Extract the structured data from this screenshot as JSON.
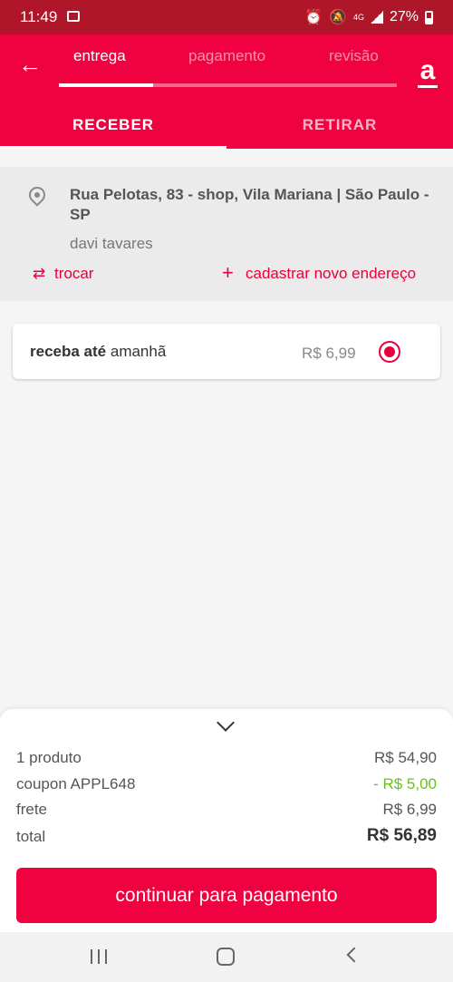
{
  "status_bar": {
    "time": "11:49",
    "network": "4G",
    "battery": "27%"
  },
  "header": {
    "steps": [
      {
        "label": "entrega",
        "active": true
      },
      {
        "label": "pagamento",
        "active": false
      },
      {
        "label": "revisão",
        "active": false
      }
    ],
    "progress_fraction": 0.28,
    "logo": "a",
    "tabs": [
      {
        "label": "RECEBER",
        "active": true
      },
      {
        "label": "RETIRAR",
        "active": false
      }
    ]
  },
  "address": {
    "line": "Rua Pelotas, 83 - shop, Vila Mariana | São Paulo - SP",
    "name": "davi tavares",
    "swap_label": "trocar",
    "new_address_label": "cadastrar novo endereço"
  },
  "delivery_option": {
    "label_bold": "receba até",
    "label_rest": "amanhã",
    "price": "R$ 6,99",
    "selected": true
  },
  "summary": {
    "rows": [
      {
        "label": "1 produto",
        "value": "R$ 54,90"
      },
      {
        "label": "coupon APPL648",
        "value": "- R$ 5,00"
      },
      {
        "label": "frete",
        "value": "R$ 6,99"
      },
      {
        "label": "total",
        "value": "R$ 56,89"
      }
    ],
    "cta_label": "continuar para pagamento"
  },
  "colors": {
    "brand": "#f0013f",
    "status_bar": "#b01629",
    "discount": "#6cbf1e"
  }
}
